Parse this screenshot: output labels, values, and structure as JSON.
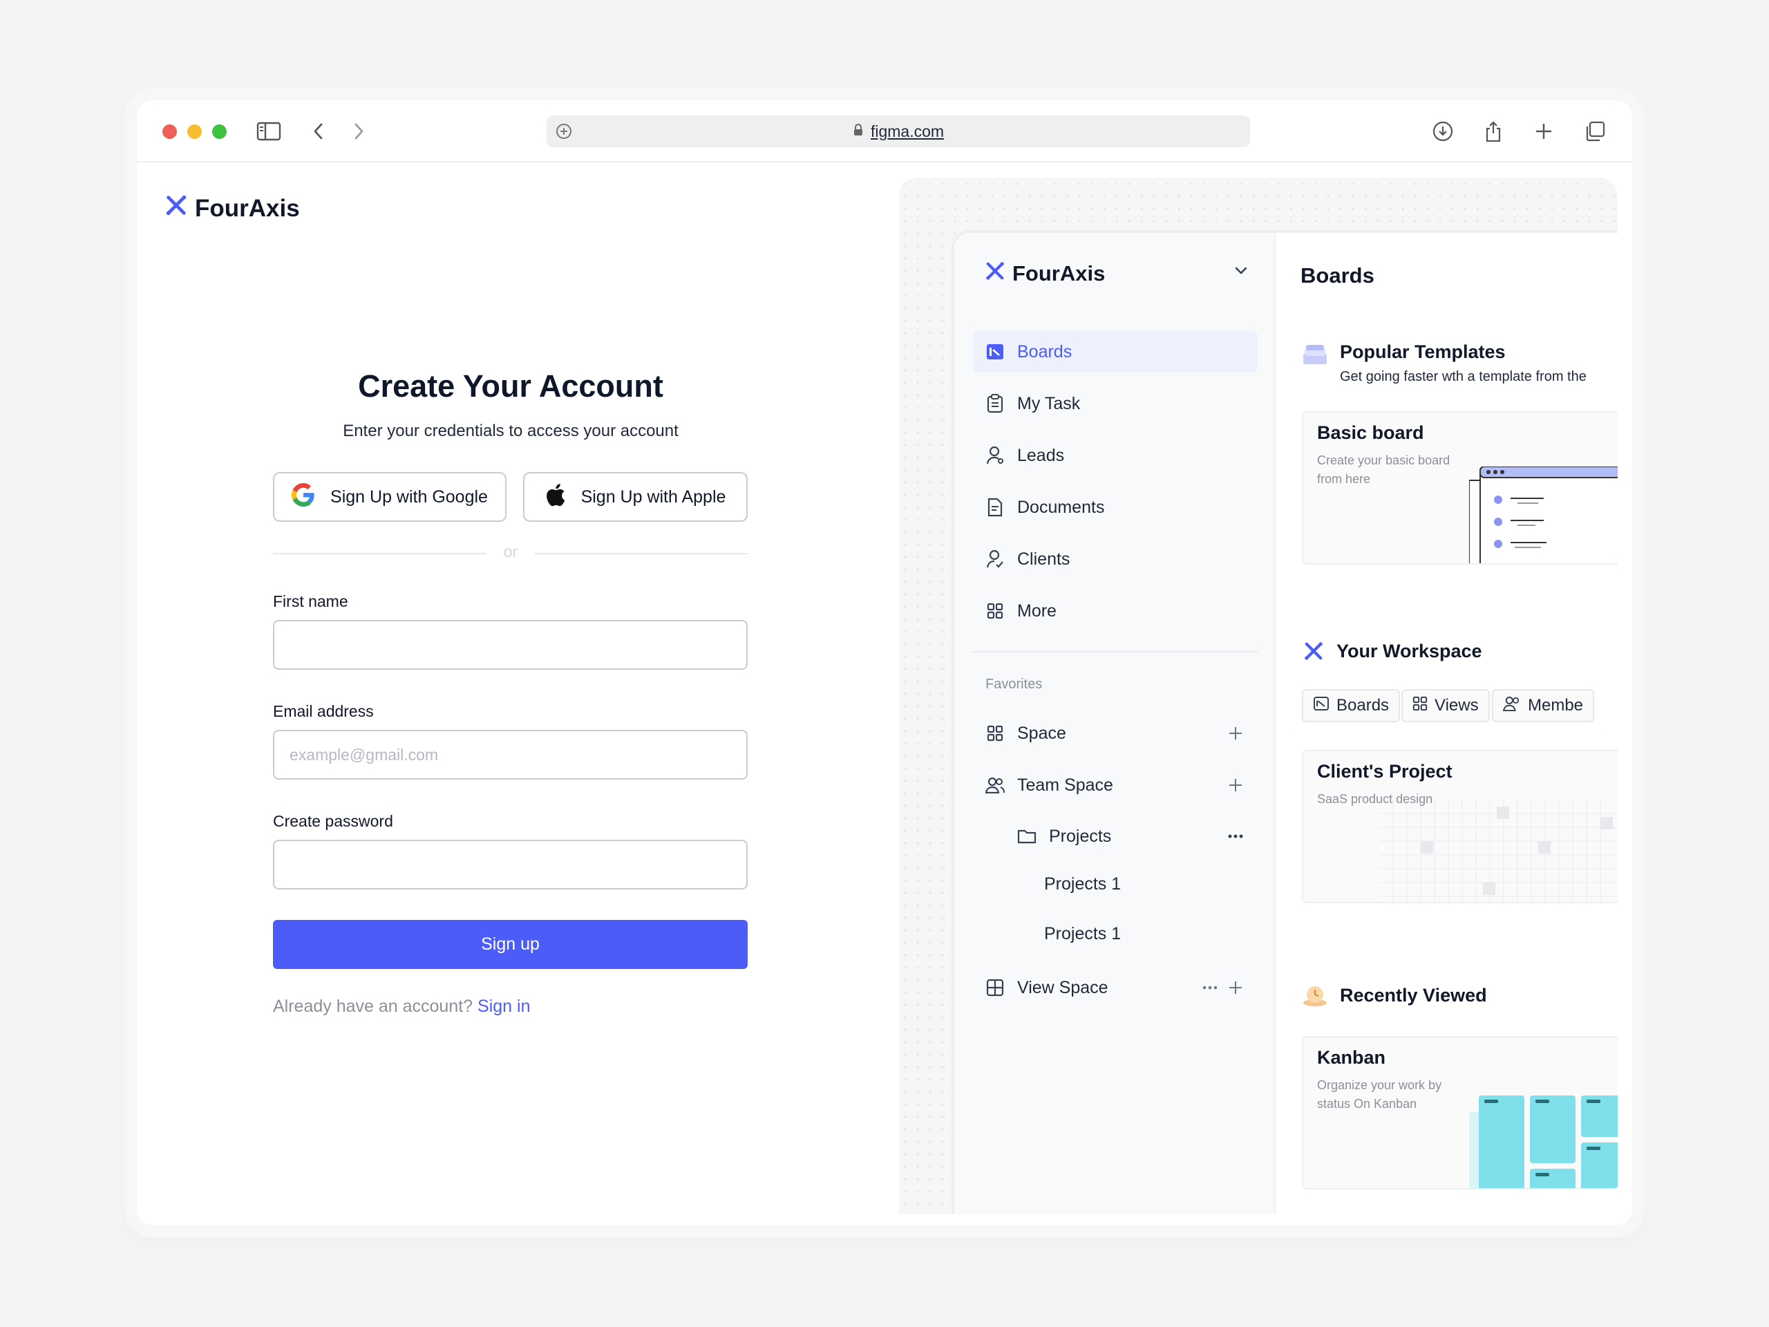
{
  "browser": {
    "url": "figma.com"
  },
  "signup": {
    "brand": "FourAxis",
    "title": "Create Your Account",
    "subtitle": "Enter your credentials to access your account",
    "google_label": "Sign Up with Google",
    "apple_label": "Sign Up with Apple",
    "divider_text": "or",
    "first_name_label": "First name",
    "first_name_value": "",
    "email_label": "Email address",
    "email_placeholder": "example@gmail.com",
    "password_label": "Create password",
    "submit_label": "Sign up",
    "signin_prompt": "Already have an account?",
    "signin_link": "Sign in"
  },
  "app": {
    "workspace_name": "FourAxis",
    "nav": [
      {
        "label": "Boards",
        "icon": "boards-icon",
        "active": true
      },
      {
        "label": "My Task",
        "icon": "clipboard-icon"
      },
      {
        "label": "Leads",
        "icon": "user-icon"
      },
      {
        "label": "Documents",
        "icon": "document-icon"
      },
      {
        "label": "Clients",
        "icon": "user-check-icon"
      },
      {
        "label": "More",
        "icon": "grid-icon"
      }
    ],
    "favorites_label": "Favorites",
    "favorites": {
      "space": "Space",
      "team_space": "Team Space",
      "projects": "Projects",
      "project_items": [
        "Projects 1",
        "Projects 1"
      ],
      "view_space": "View Space"
    },
    "main": {
      "title": "Boards",
      "popular": {
        "title": "Popular Templates",
        "subtitle": "Get going faster wth a template from the"
      },
      "basic_board": {
        "title": "Basic board",
        "subtitle": "Create your basic board from here"
      },
      "workspace": {
        "title": "Your Workspace",
        "tabs": [
          "Boards",
          "Views",
          "Membe"
        ]
      },
      "client_project": {
        "title": "Client's Project",
        "subtitle": "SaaS product design"
      },
      "recent": {
        "title": "Recently Viewed"
      },
      "kanban": {
        "title": "Kanban",
        "subtitle": "Organize your work by status On Kanban"
      }
    }
  },
  "colors": {
    "accent": "#4b5cf7",
    "kanban_card": "#7fe0ec"
  }
}
